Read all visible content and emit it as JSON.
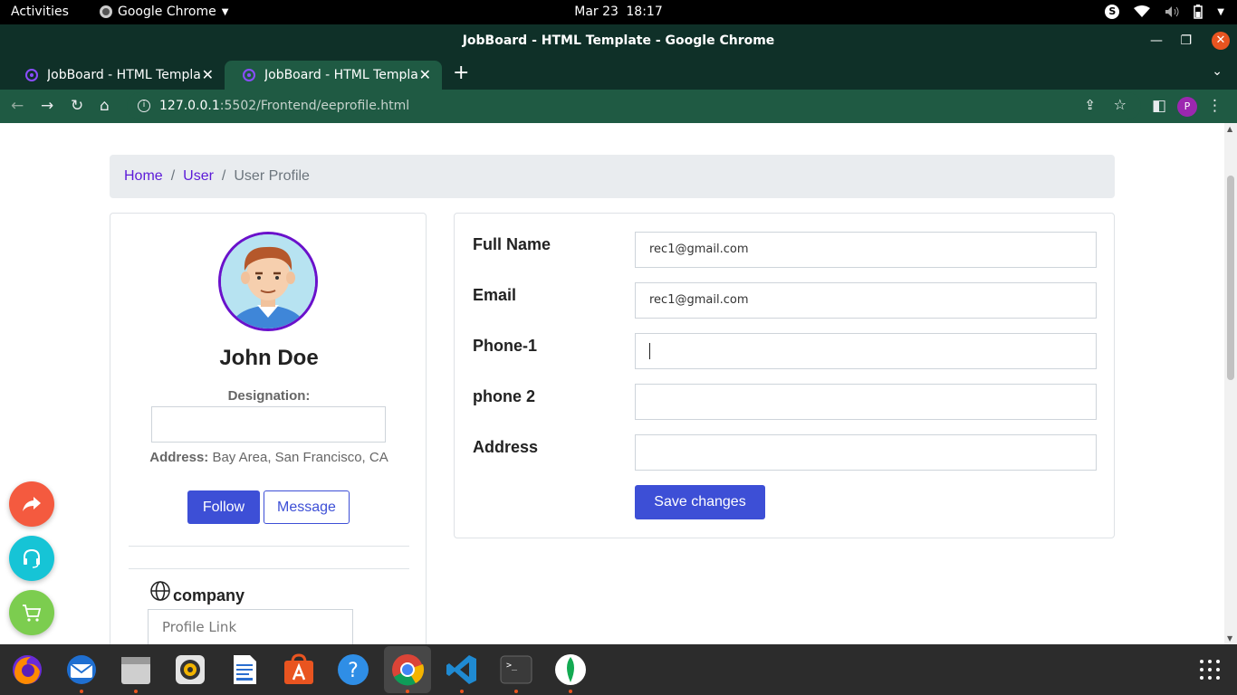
{
  "topbar": {
    "activities": "Activities",
    "app_name": "Google Chrome",
    "date": "Mar 23",
    "time": "18:17"
  },
  "window": {
    "title": "JobBoard - HTML Template - Google Chrome"
  },
  "tabs": [
    {
      "title": "JobBoard - HTML Template"
    },
    {
      "title": "JobBoard - HTML Template"
    }
  ],
  "address_bar": {
    "host": "127.0.0.1",
    "path": ":5502/Frontend/eeprofile.html"
  },
  "profile_initial": "P",
  "breadcrumb": {
    "home": "Home",
    "user": "User",
    "current": "User Profile",
    "separator": "/"
  },
  "profile": {
    "name": "John Doe",
    "designation_label": "Designation:",
    "designation_value": "",
    "address_label": "Address:",
    "address_value": " Bay Area, San Francisco, CA",
    "follow_label": "Follow",
    "message_label": "Message",
    "company_label": "company",
    "profile_link_placeholder": "Profile  Link"
  },
  "form": {
    "full_name_label": "Full Name",
    "full_name_value": "rec1@gmail.com",
    "email_label": "Email",
    "email_value": "rec1@gmail.com",
    "phone1_label": "Phone-1",
    "phone1_value": "",
    "phone2_label": "phone 2",
    "phone2_value": "",
    "address_label": "Address",
    "address_value": "",
    "save_label": "Save changes"
  },
  "colors": {
    "accent": "#3d4fd6",
    "link": "#5c1ad8",
    "chrome_frame": "#0f3028",
    "chrome_toolbar": "#1f5a43"
  }
}
